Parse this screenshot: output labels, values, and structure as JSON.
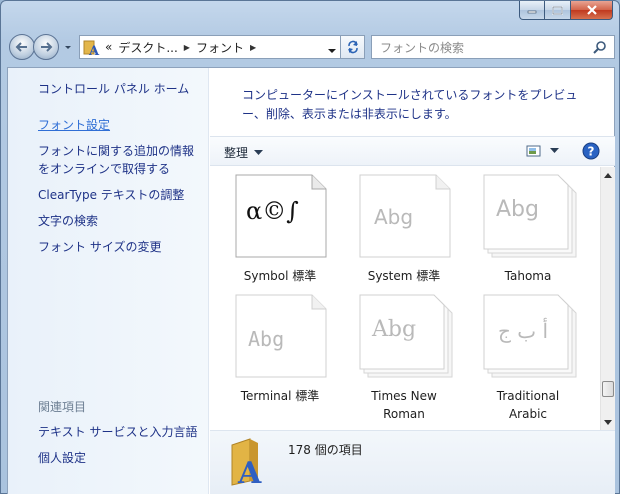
{
  "window": {
    "minimize_icon": "minimize-icon",
    "maximize_icon": "maximize-icon",
    "close_icon": "close-icon"
  },
  "address": {
    "prefix": "«",
    "crumbs": [
      "デスクト...",
      "フォント"
    ],
    "search_placeholder": "フォントの検索"
  },
  "sidebar": {
    "home": "コントロール パネル ホーム",
    "items": [
      "フォント設定",
      "フォントに関する追加の情報",
      "をオンラインで取得する",
      "ClearType テキストの調整",
      "文字の検索",
      "フォント サイズの変更"
    ],
    "related_heading": "関連項目",
    "related": [
      "テキスト サービスと入力言語",
      "個人設定"
    ]
  },
  "main": {
    "description_line1": "コンピューターにインストールされているフォントをプレビュ",
    "description_line2": "ー、削除、表示または非表示にします。",
    "organize_label": "整理",
    "fonts": [
      {
        "name": "Symbol 標準",
        "sample": "α©∫"
      },
      {
        "name": "System 標準",
        "sample": "Abg"
      },
      {
        "name": "Tahoma",
        "sample": "Abg"
      },
      {
        "name": "Terminal 標準",
        "sample": "Abg"
      },
      {
        "name": "Times New",
        "name2": "Roman",
        "sample": "Abg"
      },
      {
        "name": "Traditional",
        "name2": "Arabic",
        "sample": "أ ب ج"
      }
    ],
    "status_count": "178 個の項目"
  },
  "colors": {
    "link": "#1e3287",
    "selected_link": "#2f6ed5",
    "help": "#2a63c3"
  }
}
